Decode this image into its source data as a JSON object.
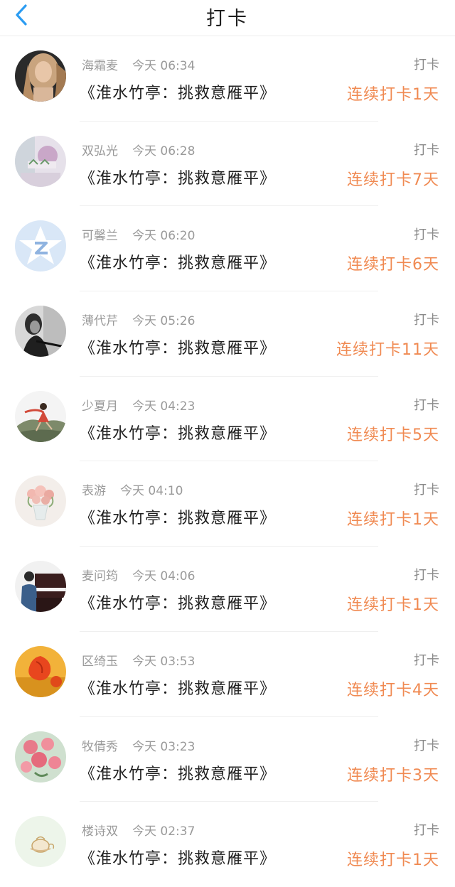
{
  "header": {
    "title": "打卡",
    "back_icon": "chevron-left-icon",
    "accent_color": "#2b9cf2"
  },
  "colors": {
    "streak": "#f08a52",
    "meta": "#9a9a9a",
    "divider": "#efefef"
  },
  "items": [
    {
      "name": "海霜麦",
      "time": "今天 06:34",
      "course": "《淮水竹亭：挑救意雁平》",
      "tag": "打卡",
      "streak": "连续打卡1天",
      "avatar": "photo-woman-portrait"
    },
    {
      "name": "双弘光",
      "time": "今天 06:28",
      "course": "《淮水竹亭：挑救意雁平》",
      "tag": "打卡",
      "streak": "连续打卡7天",
      "avatar": "photo-pastel-scene"
    },
    {
      "name": "可馨兰",
      "time": "今天 06:20",
      "course": "《淮水竹亭：挑救意雁平》",
      "tag": "打卡",
      "streak": "连续打卡6天",
      "avatar": "default-star-avatar"
    },
    {
      "name": "薄代芹",
      "time": "今天 05:26",
      "course": "《淮水竹亭：挑救意雁平》",
      "tag": "打卡",
      "streak": "连续打卡11天",
      "avatar": "photo-bw-flute"
    },
    {
      "name": "少夏月",
      "time": "今天 04:23",
      "course": "《淮水竹亭：挑救意雁平》",
      "tag": "打卡",
      "streak": "连续打卡5天",
      "avatar": "photo-dancer-mountain"
    },
    {
      "name": "表游",
      "time": "今天 04:10",
      "course": "《淮水竹亭：挑救意雁平》",
      "tag": "打卡",
      "streak": "连续打卡1天",
      "avatar": "photo-flower-vase"
    },
    {
      "name": "麦问筠",
      "time": "今天 04:06",
      "course": "《淮水竹亭：挑救意雁平》",
      "tag": "打卡",
      "streak": "连续打卡1天",
      "avatar": "photo-piano-player"
    },
    {
      "name": "区绮玉",
      "time": "今天 03:53",
      "course": "《淮水竹亭：挑救意雁平》",
      "tag": "打卡",
      "streak": "连续打卡4天",
      "avatar": "photo-orange-flower"
    },
    {
      "name": "牧倩秀",
      "time": "今天 03:23",
      "course": "《淮水竹亭：挑救意雁平》",
      "tag": "打卡",
      "streak": "连续打卡3天",
      "avatar": "photo-pink-roses"
    },
    {
      "name": "楼诗双",
      "time": "今天 02:37",
      "course": "《淮水竹亭：挑救意雁平》",
      "tag": "打卡",
      "streak": "连续打卡1天",
      "avatar": "drawing-teapot"
    }
  ]
}
